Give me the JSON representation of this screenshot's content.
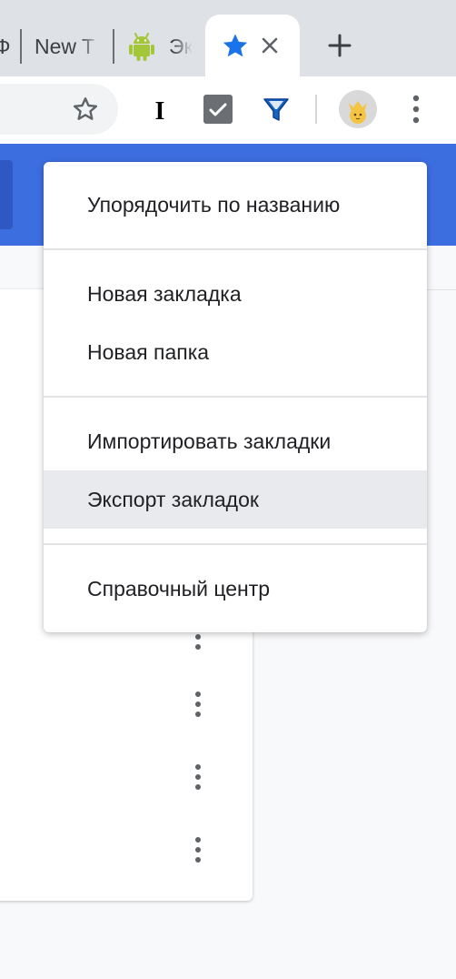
{
  "tabs": [
    {
      "label": "Ф"
    },
    {
      "label": "New T"
    },
    {
      "label": "Эк"
    },
    {
      "label": "",
      "active": true
    }
  ],
  "menu": {
    "items": [
      {
        "label": "Упорядочить по названию"
      },
      {
        "label": "Новая закладка"
      },
      {
        "label": "Новая папка"
      },
      {
        "label": "Импортировать закладки"
      },
      {
        "label": "Экспорт закладок",
        "highlighted": true
      },
      {
        "label": "Справочный центр"
      }
    ]
  },
  "icons": {
    "android": "android-icon",
    "bookmark_star": "star-icon",
    "close": "close-icon",
    "new_tab": "plus-icon",
    "omnibox_star": "star-outline-icon",
    "ext1": "instapaper-i-icon",
    "ext2": "check-badge-icon",
    "ext3": "funnel-icon",
    "profile": "avatar",
    "menu": "kebab-icon"
  },
  "colors": {
    "accent_blue": "#3d6ee0",
    "bookmark_star": "#1a73e8",
    "android_green": "#a4c639",
    "highlight": "#e8eaed"
  }
}
